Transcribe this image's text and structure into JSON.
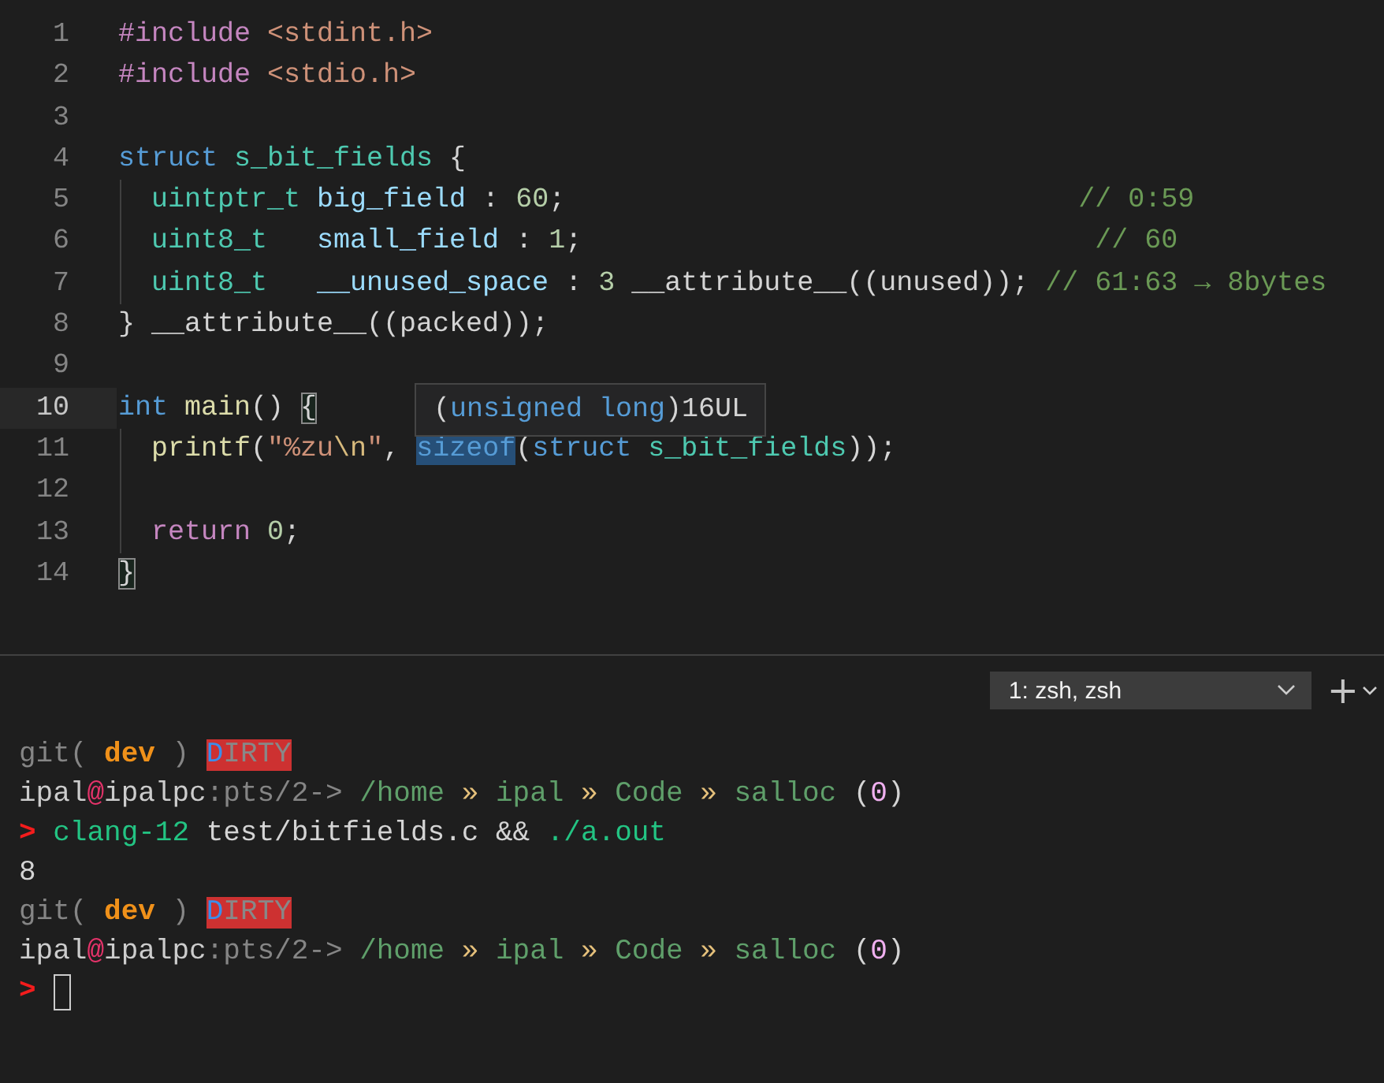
{
  "editor": {
    "lines": [
      {
        "number": "1",
        "current": false,
        "guide": false,
        "tokens": [
          {
            "text": "#include ",
            "kind": "macro"
          },
          {
            "text": "<stdint.h>",
            "kind": "string"
          }
        ]
      },
      {
        "number": "2",
        "current": false,
        "guide": false,
        "tokens": [
          {
            "text": "#include ",
            "kind": "macro"
          },
          {
            "text": "<stdio.h>",
            "kind": "string"
          }
        ]
      },
      {
        "number": "3",
        "current": false,
        "guide": false
      },
      {
        "number": "4",
        "current": false,
        "guide": false,
        "tokens": [
          {
            "text": "struct ",
            "kind": "keyword"
          },
          {
            "text": "s_bit_fields",
            "kind": "type"
          },
          {
            "text": " {",
            "kind": "plain"
          }
        ]
      },
      {
        "number": "5",
        "current": false,
        "guide": true,
        "tokens": [
          {
            "text": "  uintptr_t ",
            "kind": "type"
          },
          {
            "text": "big_field",
            "kind": "var"
          },
          {
            "text": " : ",
            "kind": "plain"
          },
          {
            "text": "60",
            "kind": "number"
          },
          {
            "text": ";                               ",
            "kind": "plain"
          },
          {
            "text": "// 0:59",
            "kind": "comment"
          }
        ]
      },
      {
        "number": "6",
        "current": false,
        "guide": true,
        "tokens": [
          {
            "text": "  uint8_t   ",
            "kind": "type"
          },
          {
            "text": "small_field",
            "kind": "var"
          },
          {
            "text": " : ",
            "kind": "plain"
          },
          {
            "text": "1",
            "kind": "number"
          },
          {
            "text": ";                               ",
            "kind": "plain"
          },
          {
            "text": "// 60",
            "kind": "comment"
          }
        ]
      },
      {
        "number": "7",
        "current": false,
        "guide": true,
        "tokens": [
          {
            "text": "  uint8_t   ",
            "kind": "type"
          },
          {
            "text": "__unused_space",
            "kind": "var"
          },
          {
            "text": " : ",
            "kind": "plain"
          },
          {
            "text": "3",
            "kind": "number"
          },
          {
            "text": " __attribute__((unused)); ",
            "kind": "plain"
          },
          {
            "text": "// 61:63 → 8bytes",
            "kind": "comment"
          }
        ]
      },
      {
        "number": "8",
        "current": false,
        "guide": false,
        "tokens": [
          {
            "text": "} __attribute__((packed));",
            "kind": "plain"
          }
        ]
      },
      {
        "number": "9",
        "current": false,
        "guide": false
      },
      {
        "number": "10",
        "current": true,
        "guide": false,
        "tokens": [
          {
            "text": "int ",
            "kind": "keyword"
          },
          {
            "text": "main",
            "kind": "func"
          },
          {
            "text": "() ",
            "kind": "plain"
          },
          {
            "text": "{",
            "kind": "match"
          }
        ]
      },
      {
        "number": "11",
        "current": false,
        "guide": true,
        "tokens": [
          {
            "text": "  printf",
            "kind": "func"
          },
          {
            "text": "(",
            "kind": "plain"
          },
          {
            "text": "\"%zu",
            "kind": "string"
          },
          {
            "text": "\\n",
            "kind": "escape"
          },
          {
            "text": "\"",
            "kind": "string"
          },
          {
            "text": ", ",
            "kind": "plain"
          },
          {
            "text": "sizeof",
            "kind": "hover"
          },
          {
            "text": "(",
            "kind": "plain"
          },
          {
            "text": "struct ",
            "kind": "keyword"
          },
          {
            "text": "s_bit_fields",
            "kind": "type"
          },
          {
            "text": "));",
            "kind": "plain"
          }
        ]
      },
      {
        "number": "12",
        "current": false,
        "guide": true
      },
      {
        "number": "13",
        "current": false,
        "guide": true,
        "tokens": [
          {
            "text": "  return ",
            "kind": "control"
          },
          {
            "text": "0",
            "kind": "number"
          },
          {
            "text": ";",
            "kind": "plain"
          }
        ]
      },
      {
        "number": "14",
        "current": false,
        "guide": false,
        "tokens": [
          {
            "text": "}",
            "kind": "match"
          }
        ]
      }
    ],
    "tooltip": {
      "tokens": [
        {
          "text": "(",
          "kind": "plain"
        },
        {
          "text": "unsigned long",
          "kind": "keyword"
        },
        {
          "text": ")16UL",
          "kind": "plain"
        }
      ]
    }
  },
  "terminal": {
    "tab_selector": {
      "value": "1: zsh, zsh"
    },
    "new_terminal": "+",
    "lines": [
      {
        "tokens": [
          {
            "text": "git( ",
            "kind": "dim"
          },
          {
            "text": "dev",
            "kind": "branch"
          },
          {
            "text": " ) ",
            "kind": "dim"
          },
          {
            "text": "D",
            "kind": "dirty-head"
          },
          {
            "text": "IRTY",
            "kind": "dirty-tail"
          }
        ]
      },
      {
        "tokens": [
          {
            "text": "ipal",
            "kind": "user"
          },
          {
            "text": "@",
            "kind": "at"
          },
          {
            "text": "ipalpc",
            "kind": "user"
          },
          {
            "text": ":pts/2-> ",
            "kind": "dim"
          },
          {
            "text": "/home",
            "kind": "path"
          },
          {
            "text": " » ",
            "kind": "sep"
          },
          {
            "text": "ipal",
            "kind": "path"
          },
          {
            "text": " » ",
            "kind": "sep"
          },
          {
            "text": "Code",
            "kind": "path"
          },
          {
            "text": " » ",
            "kind": "sep"
          },
          {
            "text": "salloc",
            "kind": "path"
          },
          {
            "text": " (",
            "kind": "plain"
          },
          {
            "text": "0",
            "kind": "status"
          },
          {
            "text": ")",
            "kind": "plain"
          }
        ]
      },
      {
        "tokens": [
          {
            "text": "> ",
            "kind": "prompt"
          },
          {
            "text": "clang-12",
            "kind": "cmd"
          },
          {
            "text": " test/bitfields.c && ",
            "kind": "plain"
          },
          {
            "text": "./a.out",
            "kind": "cmd"
          }
        ]
      },
      {
        "tokens": [
          {
            "text": "8",
            "kind": "plain"
          }
        ]
      },
      {
        "tokens": [
          {
            "text": "git( ",
            "kind": "dim"
          },
          {
            "text": "dev",
            "kind": "branch"
          },
          {
            "text": " ) ",
            "kind": "dim"
          },
          {
            "text": "D",
            "kind": "dirty-head"
          },
          {
            "text": "IRTY",
            "kind": "dirty-tail"
          }
        ]
      },
      {
        "tokens": [
          {
            "text": "ipal",
            "kind": "user"
          },
          {
            "text": "@",
            "kind": "at"
          },
          {
            "text": "ipalpc",
            "kind": "user"
          },
          {
            "text": ":pts/2-> ",
            "kind": "dim"
          },
          {
            "text": "/home",
            "kind": "path"
          },
          {
            "text": " » ",
            "kind": "sep"
          },
          {
            "text": "ipal",
            "kind": "path"
          },
          {
            "text": " » ",
            "kind": "sep"
          },
          {
            "text": "Code",
            "kind": "path"
          },
          {
            "text": " » ",
            "kind": "sep"
          },
          {
            "text": "salloc",
            "kind": "path"
          },
          {
            "text": " (",
            "kind": "plain"
          },
          {
            "text": "0",
            "kind": "status"
          },
          {
            "text": ")",
            "kind": "plain"
          }
        ]
      },
      {
        "tokens": [
          {
            "text": ">",
            "kind": "prompt"
          }
        ],
        "cursor": true
      }
    ]
  }
}
